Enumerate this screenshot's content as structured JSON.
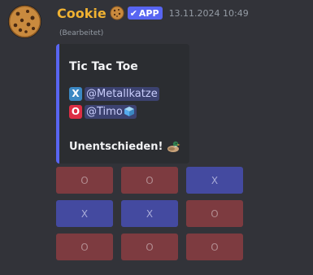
{
  "message": {
    "author": "Cookie",
    "author_emoji": "cookie-icon",
    "badge": "APP",
    "timestamp": "13.11.2024 10:49",
    "edited_label": "(Bearbeitet)",
    "colors": {
      "username": "#f0b232",
      "badge": "#5865f2",
      "embed_border": "#5865f2"
    }
  },
  "embed": {
    "title": "Tic Tac Toe",
    "players": [
      {
        "mark": "X",
        "mention": "@Metallkatze",
        "icon": "x-emoji-icon"
      },
      {
        "mark": "O",
        "mention": "@Timo",
        "icon": "o-emoji-icon",
        "suffix_icon": "ice-cube-icon"
      }
    ],
    "result": "Unentschieden!",
    "result_icon": "duck-icon"
  },
  "board": {
    "cells": [
      {
        "label": "O",
        "color": "red"
      },
      {
        "label": "O",
        "color": "red"
      },
      {
        "label": "X",
        "color": "blue"
      },
      {
        "label": "X",
        "color": "blue"
      },
      {
        "label": "X",
        "color": "blue"
      },
      {
        "label": "O",
        "color": "red"
      },
      {
        "label": "O",
        "color": "red"
      },
      {
        "label": "O",
        "color": "red"
      },
      {
        "label": "O",
        "color": "red"
      }
    ]
  }
}
